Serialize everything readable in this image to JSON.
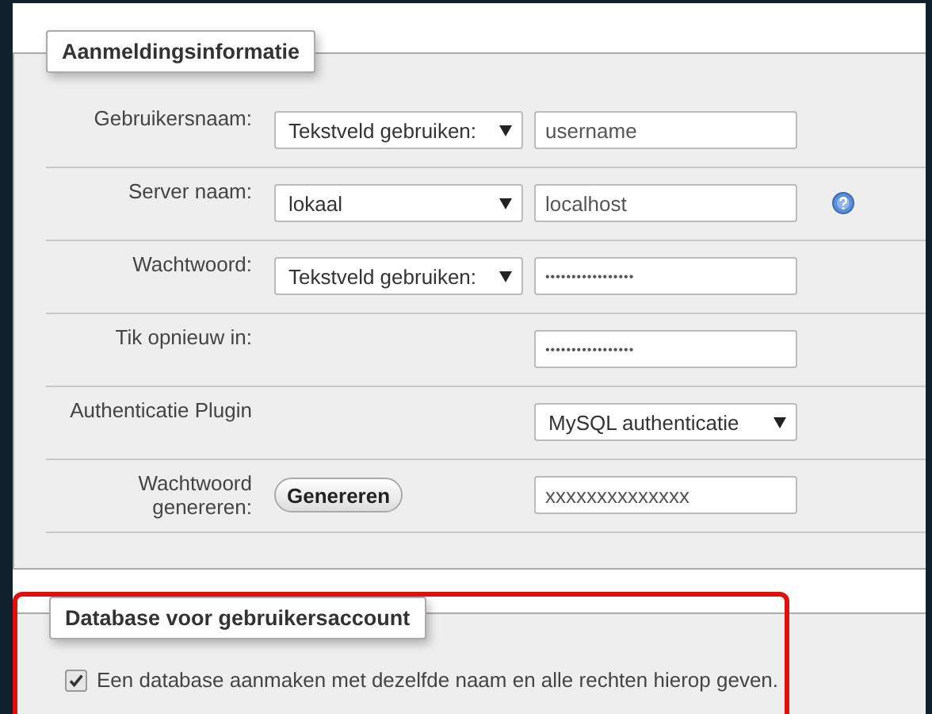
{
  "login_section": {
    "legend": "Aanmeldingsinformatie",
    "rows": [
      {
        "label": "Gebruikersnaam:",
        "control": {
          "kind": "select",
          "value": "Tekstveld gebruiken:"
        },
        "field": {
          "kind": "text",
          "value": "username"
        },
        "help": false
      },
      {
        "label": "Server naam:",
        "control": {
          "kind": "select",
          "value": "lokaal"
        },
        "field": {
          "kind": "text",
          "value": "localhost"
        },
        "help": true
      },
      {
        "label": "Wachtwoord:",
        "control": {
          "kind": "select",
          "value": "Tekstveld gebruiken:"
        },
        "field": {
          "kind": "password",
          "value": "•••••••••••••••••"
        },
        "help": false
      },
      {
        "label": "Tik opnieuw in:",
        "field": {
          "kind": "password",
          "value": "•••••••••••••••••"
        },
        "help": false
      },
      {
        "label": "Authenticatie Plugin",
        "field": {
          "kind": "select",
          "value": "MySQL authenticatie"
        },
        "help": false
      },
      {
        "label": "Wachtwoord genereren:",
        "control": {
          "kind": "button",
          "value": "Genereren"
        },
        "field": {
          "kind": "text",
          "value": "xxxxxxxxxxxxxx"
        },
        "help": false
      }
    ]
  },
  "database_section": {
    "legend": "Database voor gebruikersaccount",
    "highlighted": true,
    "option": {
      "label": "Een database aanmaken met dezelfde naam en alle rechten hierop geven.",
      "checked": true
    }
  }
}
